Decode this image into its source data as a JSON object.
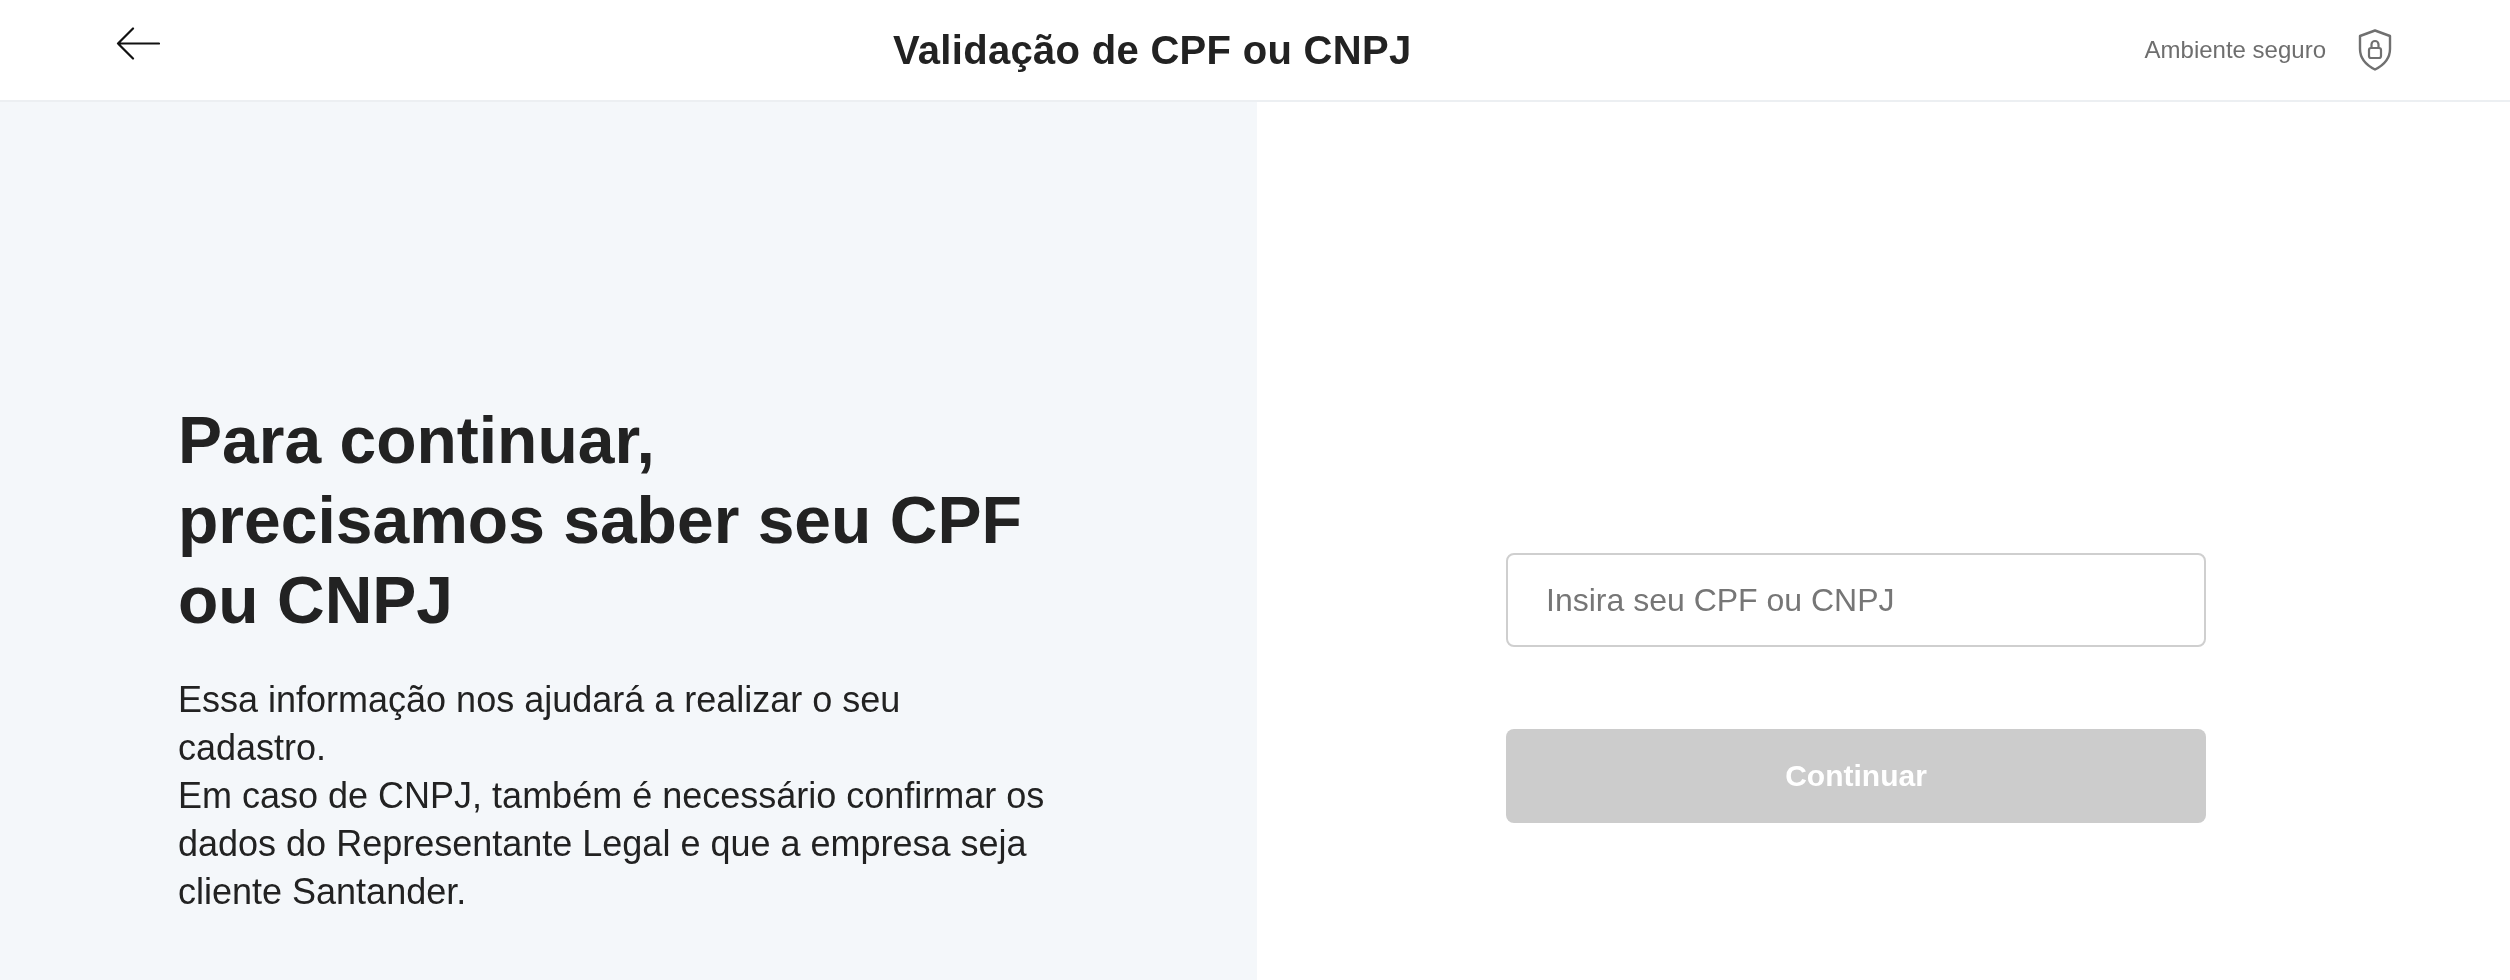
{
  "header": {
    "title": "Validação de CPF ou CNPJ",
    "secure_label": "Ambiente seguro"
  },
  "intro": {
    "heading": "Para continuar, precisamos saber seu CPF ou CNPJ",
    "paragraphs": [
      "Essa informação nos ajudará a realizar o seu cadastro.",
      "Em caso de CNPJ, também é necessário confirmar os dados do Representante Legal e que a empresa seja cliente Santander."
    ]
  },
  "form": {
    "document_field": {
      "placeholder": "Insira seu CPF ou CNPJ"
    },
    "continue_button": {
      "label": "Continuar",
      "disabled": true
    }
  }
}
